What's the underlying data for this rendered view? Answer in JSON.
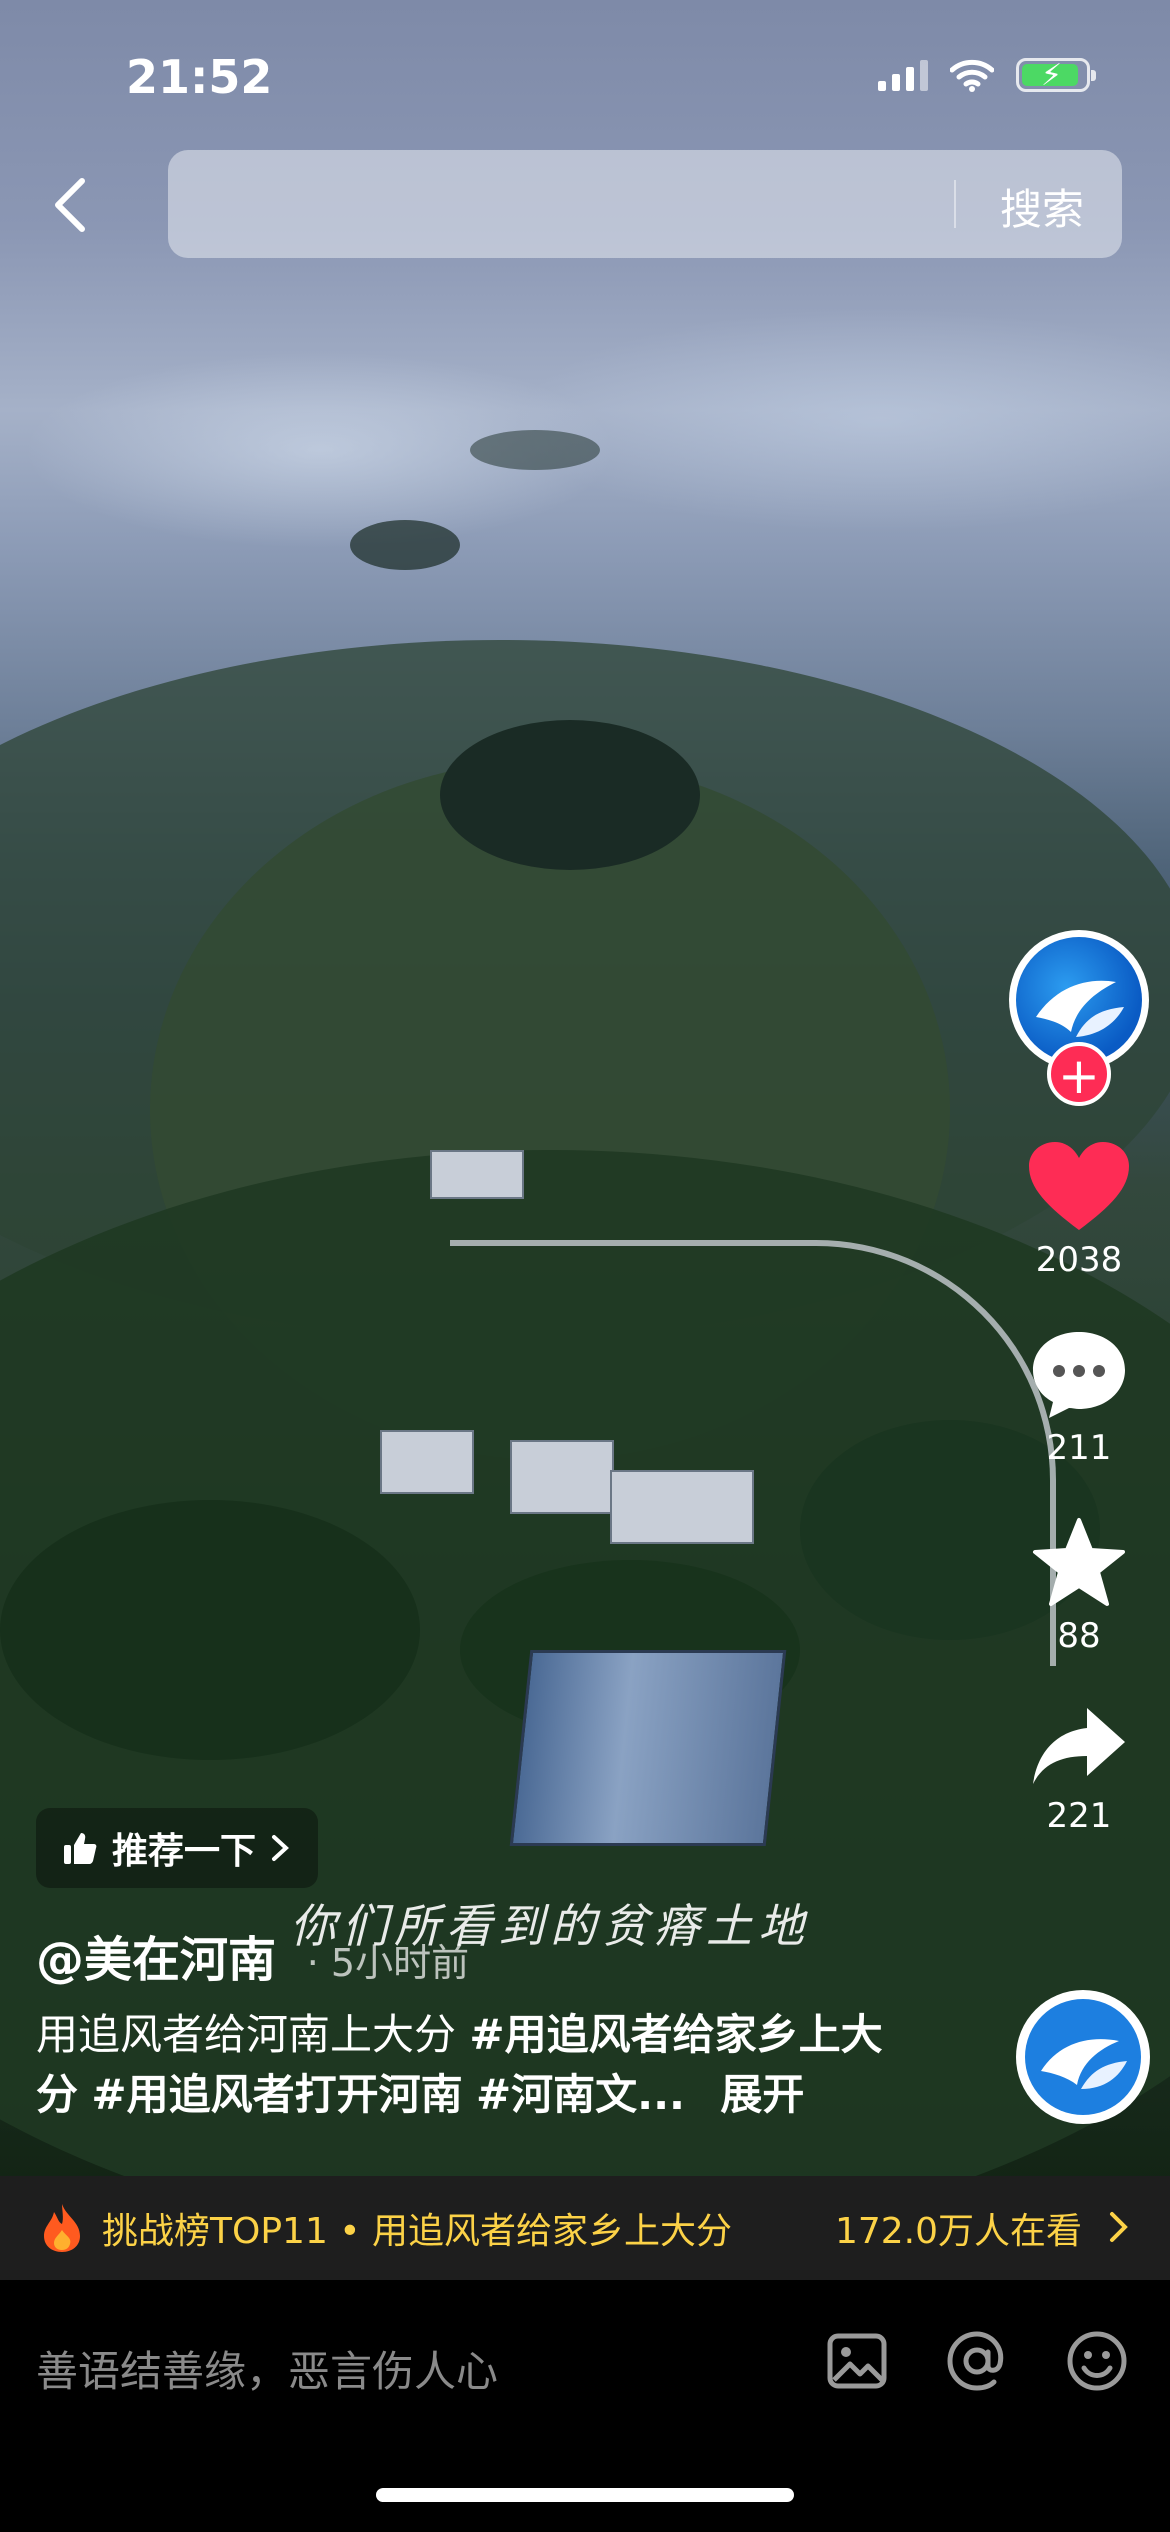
{
  "status_bar": {
    "time": "21:52"
  },
  "search": {
    "placeholder": "",
    "button_label": "搜索"
  },
  "video": {
    "overlay_caption": "你们所看到的贫瘠土地"
  },
  "creator": {
    "handle": "@美在河南",
    "time_ago": "5小时前"
  },
  "rail": {
    "likes": "2038",
    "comments": "211",
    "favorites": "88",
    "shares": "221"
  },
  "recommend": {
    "label": "推荐一下"
  },
  "description": {
    "text": "用追风者给河南上大分",
    "tags": [
      "#用追风者给家乡上大分",
      "#用追风者打开河南",
      "#河南文..."
    ],
    "expand": "展开"
  },
  "challenge": {
    "text": "挑战榜TOP11 • 用追风者给家乡上大分",
    "watchers": "172.0万人在看"
  },
  "comment": {
    "placeholder": "善语结善缘，恶言伤人心"
  },
  "colors": {
    "accent_red": "#fe2c55",
    "challenge_yellow": "#fcd247"
  }
}
